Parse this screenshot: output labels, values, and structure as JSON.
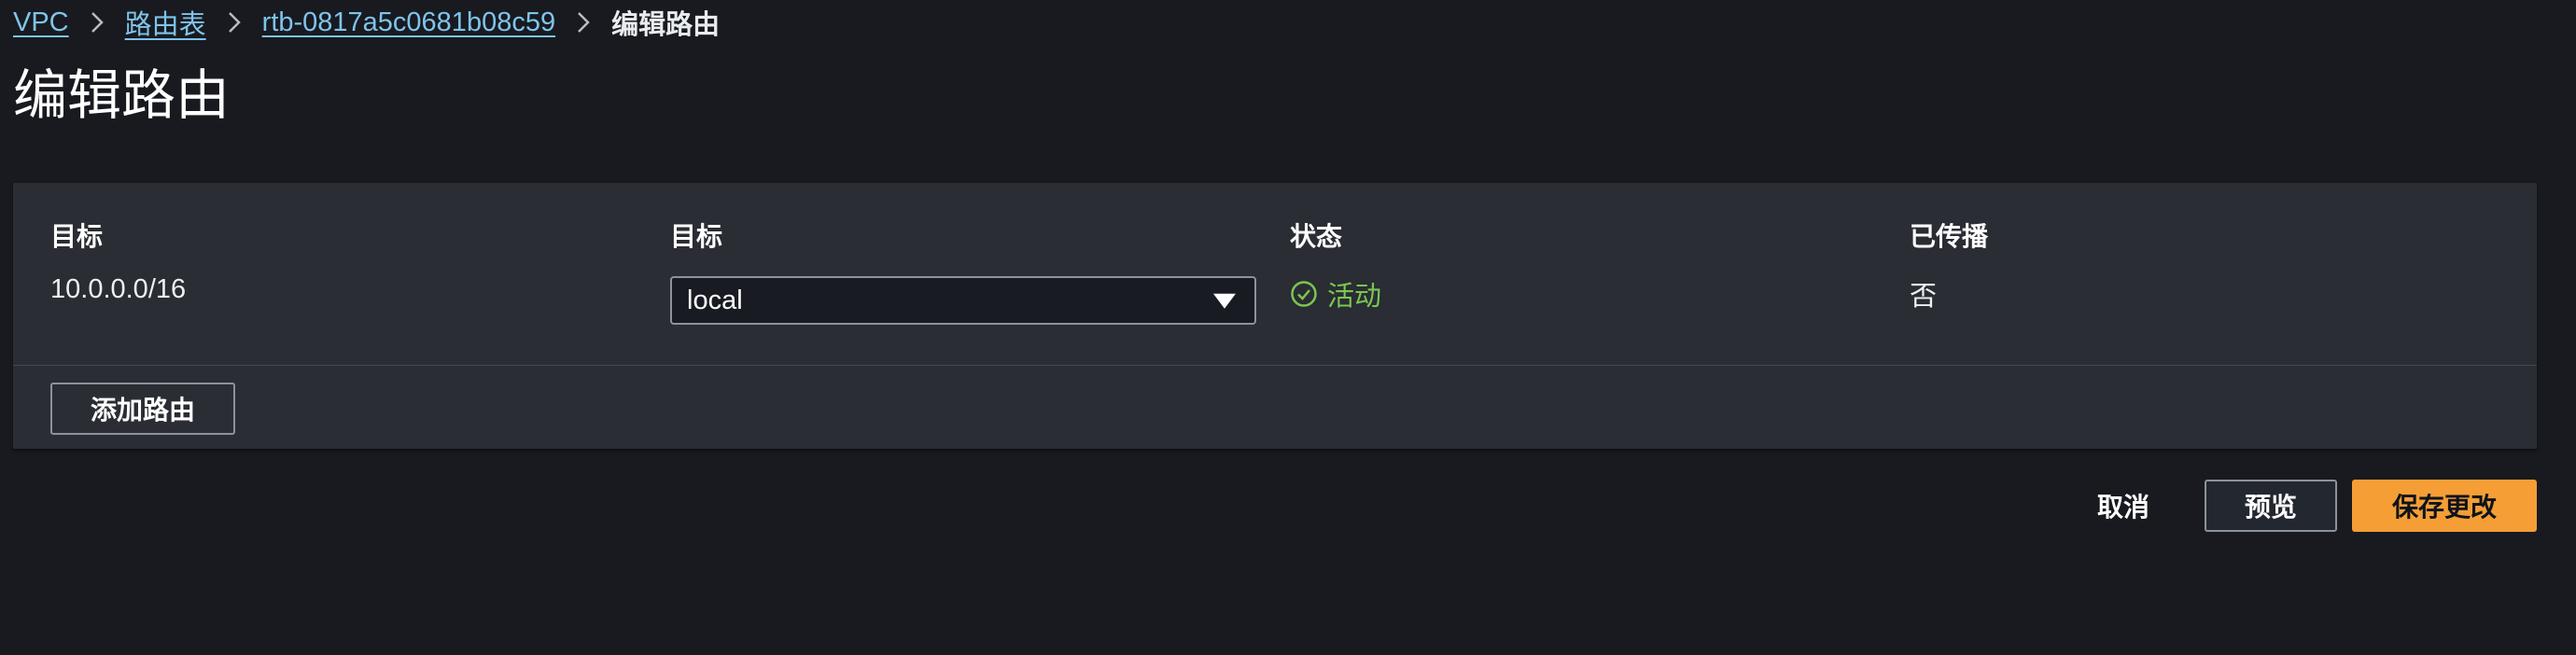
{
  "breadcrumb": {
    "items": [
      {
        "label": "VPC"
      },
      {
        "label": "路由表"
      },
      {
        "label": "rtb-0817a5c0681b08c59"
      }
    ],
    "current": "编辑路由"
  },
  "page": {
    "title": "编辑路由"
  },
  "routes_table": {
    "columns": [
      "目标",
      "目标",
      "状态",
      "已传播"
    ],
    "rows": [
      {
        "destination": "10.0.0.0/16",
        "target": "local",
        "status": "活动",
        "propagated": "否"
      }
    ],
    "add_route_label": "添加路由"
  },
  "footer": {
    "cancel_label": "取消",
    "preview_label": "预览",
    "save_label": "保存更改"
  },
  "colors": {
    "background": "#181a20",
    "panel": "#2a2d33",
    "link": "#7fc4ea",
    "status_active": "#7cc552",
    "primary_button": "#f59e36"
  },
  "icons": {
    "breadcrumb_separator": "chevron-right-icon",
    "select_arrow": "caret-down-icon",
    "status": "check-circle-icon"
  }
}
